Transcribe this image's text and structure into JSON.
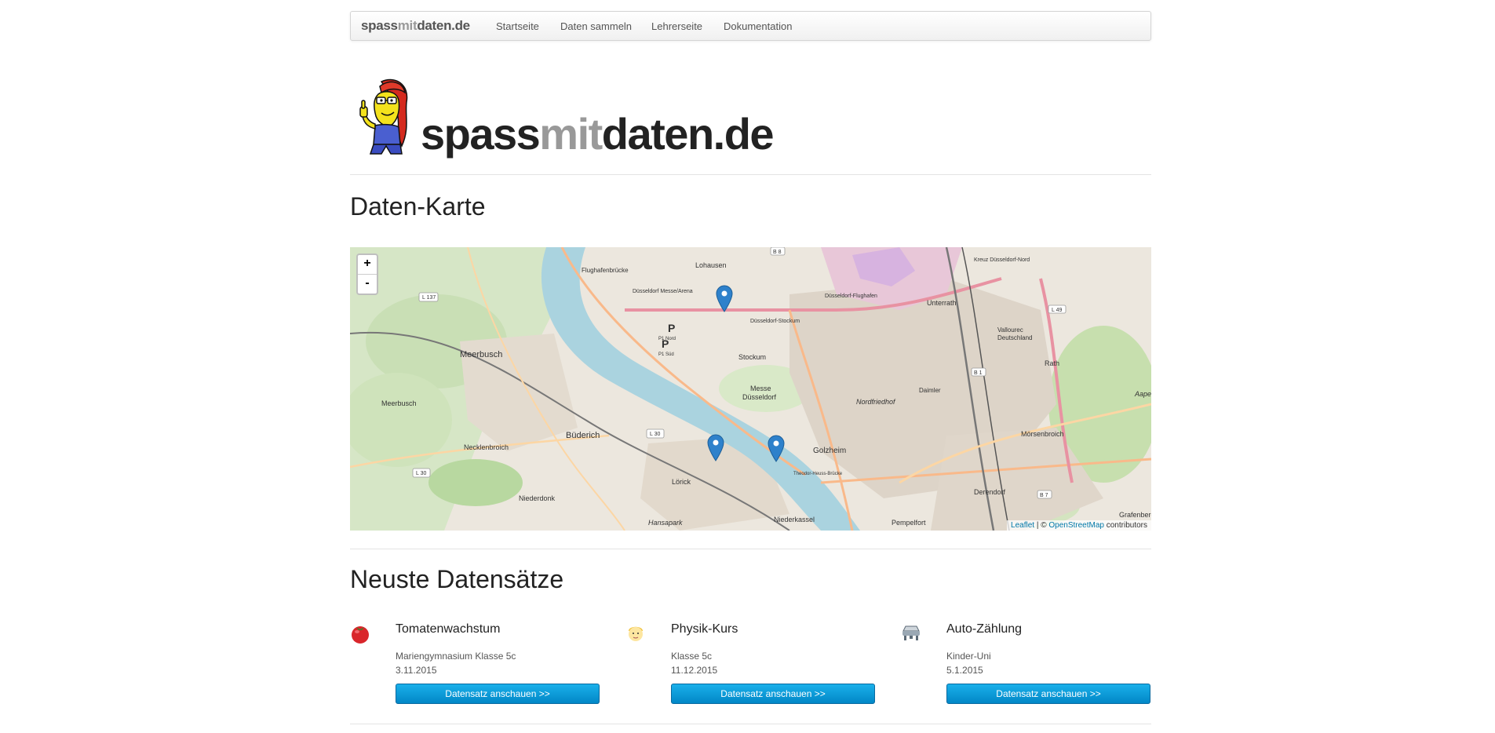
{
  "navbar": {
    "brand_start": "spass",
    "brand_mid": "mit",
    "brand_end": "daten.de",
    "links": [
      "Startseite",
      "Daten sammeln",
      "Lehrerseite",
      "Dokumentation"
    ]
  },
  "logo": {
    "text_start": "spass",
    "text_mid": "mit",
    "text_end": "daten.de"
  },
  "map_section": {
    "heading": "Daten-Karte",
    "zoom_in": "+",
    "zoom_out": "-",
    "attribution": {
      "leaflet": "Leaflet",
      "sep": " | © ",
      "osm": "OpenStreetMap",
      "suffix": " contributors"
    },
    "place_labels": [
      "Lohausen",
      "Flughafenbrücke",
      "Meerbusch",
      "Stockum",
      "Messe Düsseldorf",
      "Nordfriedhof",
      "Unterrath",
      "Büderich",
      "Necklenbroich",
      "Niederdonk",
      "Golzheim",
      "Lörick",
      "Hansapark",
      "Niederkassel",
      "Pempelfort",
      "Derendorf",
      "Mörsenbroich",
      "Rath",
      "Düsseldorf-Stockum",
      "Düsseldorf Messe/Arena",
      "Düsseldorf-Flughafen",
      "Vallourec Deutschland",
      "L 137",
      "L 30",
      "B 8",
      "B 1",
      "B 7",
      "L 49",
      "Theodor-Heuss-Brücke",
      "Grafenberg",
      "Daimler AG",
      "Aaper",
      "P",
      "P1 Nord",
      "P1 Süd",
      "Kreuz Düsseldorf-Nord"
    ],
    "markers": [
      "marker-messe",
      "marker-loerick",
      "marker-golzheim"
    ]
  },
  "datasets_section": {
    "heading": "Neuste Datensätze",
    "items": [
      {
        "icon": "tomato-icon",
        "title": "Tomatenwachstum",
        "org": "Mariengymnasium Klasse 5c",
        "date": "3.11.2015",
        "button": "Datensatz anschauen >>"
      },
      {
        "icon": "face-icon",
        "title": "Physik-Kurs",
        "org": "Klasse 5c",
        "date": "11.12.2015",
        "button": "Datensatz anschauen >>"
      },
      {
        "icon": "car-icon",
        "title": "Auto-Zählung",
        "org": "Kinder-Uni",
        "date": "5.1.2015",
        "button": "Datensatz anschauen >>"
      }
    ]
  }
}
